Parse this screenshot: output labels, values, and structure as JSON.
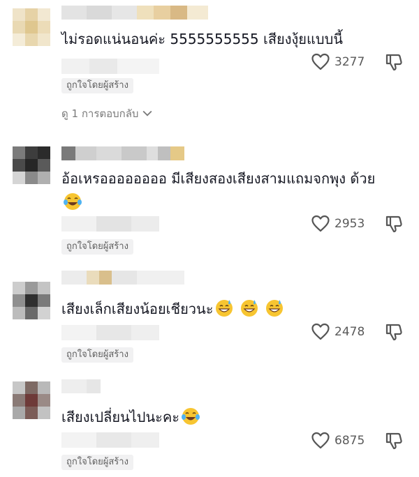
{
  "liked_by_creator_label": "ถูกใจโดยผู้สร้าง",
  "comments": [
    {
      "text": "ไม่รอดแน่นอนค่ะ 5555555555 เสียงงุ้ยแบบนี้",
      "emojis": [],
      "likes": "3277",
      "view_replies": "ดู 1 การตอบกลับ"
    },
    {
      "text": "อ้อเหรออออออออ มีเสียงสองเสียงสามแถมจกพุง ด้วย",
      "emojis": [
        "face-with-tears-of-joy-emoji"
      ],
      "likes": "2953"
    },
    {
      "text": "เสียงเล็กเสียงน้อยเชียวนะ",
      "emojis": [
        "grinning-face-with-sweat-emoji",
        "grinning-face-with-sweat-emoji",
        "grinning-face-with-sweat-emoji"
      ],
      "likes": "2478"
    },
    {
      "text": "เสียงเปลี่ยนไปนะคะ",
      "emojis": [
        "face-with-tears-of-joy-emoji"
      ],
      "likes": "6875"
    }
  ],
  "colors": {
    "text": "#161823",
    "meta": "#5f5f5f",
    "badge_bg": "#f1f1f2",
    "icon": "#555555"
  }
}
